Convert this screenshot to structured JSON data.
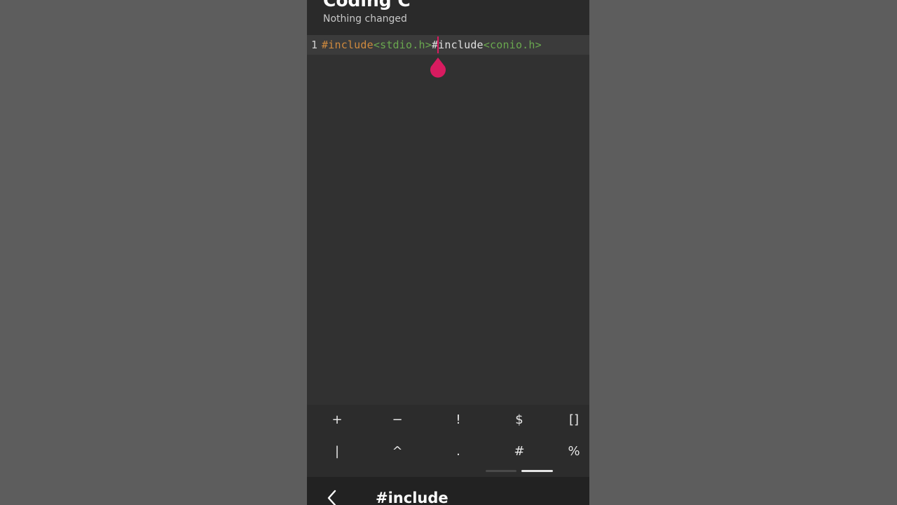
{
  "header": {
    "title": "Coding C",
    "subtitle": "Nothing changed"
  },
  "editor": {
    "line_number": "1",
    "tokens": {
      "kw1": "#include",
      "inc1": "<stdio.h>",
      "kw2": "#include",
      "inc2": "<conio.h>"
    }
  },
  "symbol_bar": {
    "row1": [
      "+",
      "−",
      "!",
      "$",
      "[]"
    ],
    "row2": [
      "|",
      "^",
      ".",
      "#",
      "%"
    ]
  },
  "bottom_bar": {
    "title": "#include",
    "back_icon": "chevron-left-icon"
  },
  "colors": {
    "keyword": "#d08a3e",
    "include_path": "#6aa84f",
    "cursor": "#d81b60",
    "background": "#313131"
  }
}
